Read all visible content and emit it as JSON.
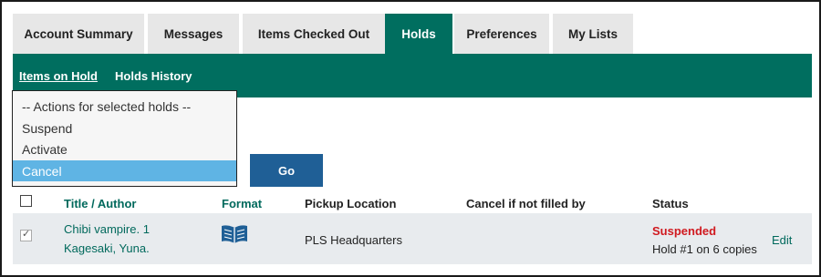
{
  "tabs": [
    {
      "label": "Account Summary",
      "active": false
    },
    {
      "label": "Messages",
      "active": false
    },
    {
      "label": "Items Checked Out",
      "active": false
    },
    {
      "label": "Holds",
      "active": true
    },
    {
      "label": "Preferences",
      "active": false
    },
    {
      "label": "My Lists",
      "active": false
    }
  ],
  "subnav": {
    "items": [
      {
        "label": "Items on Hold",
        "current": true
      },
      {
        "label": "Holds History",
        "current": false
      }
    ]
  },
  "actions": {
    "options": [
      "-- Actions for selected holds --",
      "Suspend",
      "Activate",
      "Cancel"
    ],
    "selected": "Cancel",
    "go_label": "Go"
  },
  "table": {
    "headers": {
      "title_author": "Title / Author",
      "format": "Format",
      "pickup": "Pickup Location",
      "cancel_if": "Cancel if not filled by",
      "status": "Status"
    },
    "rows": [
      {
        "checked": true,
        "title": "Chibi vampire. 1",
        "author": "Kagesaki, Yuna.",
        "format_icon": "book-icon",
        "pickup": "PLS Headquarters",
        "cancel_if": "",
        "status": "Suspended",
        "hold_info": "Hold #1 on 6 copies",
        "edit_label": "Edit"
      }
    ]
  },
  "colors": {
    "accent_green": "#006e5f",
    "link_green": "#00695c",
    "button_blue": "#1f5f96",
    "selected_blue": "#5fb4e4",
    "status_red": "#d0191f"
  }
}
